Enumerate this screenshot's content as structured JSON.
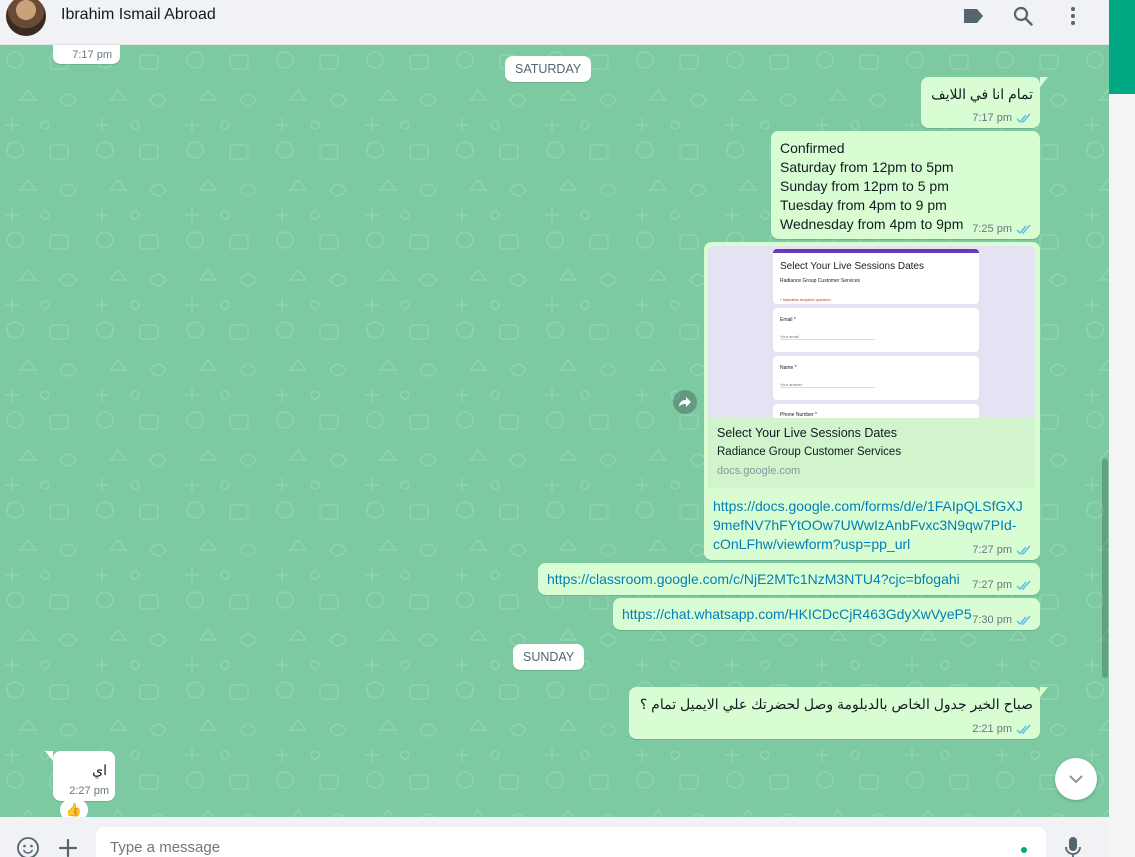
{
  "header": {
    "contact_name": "Ibrahim Ismail Abroad",
    "icons": [
      "label-icon",
      "search-icon",
      "menu-icon"
    ]
  },
  "colors": {
    "chat_background": "#7cc9a2",
    "outgoing_bubble": "#d9fdd3",
    "incoming_bubble": "#ffffff",
    "link": "#027eb5",
    "read_ticks": "#53bdeb",
    "accent": "#00a884"
  },
  "messages": {
    "prev_incoming_time": "7:17 pm",
    "date_saturday": "SATURDAY",
    "msg1": {
      "text": "تمام انا في اللايف",
      "time": "7:17 pm"
    },
    "msg2": {
      "lines": [
        "Confirmed",
        "Saturday from 12pm to 5pm",
        "Sunday from 12pm to 5 pm",
        "Tuesday from 4pm to 9 pm",
        "Wednesday from 4pm to 9pm"
      ],
      "time": "7:25 pm"
    },
    "msg3": {
      "preview_form_title": "Select Your Live Sessions Dates",
      "preview_form_subtitle": "Radiance Group Customer Services",
      "preview_form_required": "* Indicates required question",
      "preview_field_email": "Email *",
      "preview_field_email_placeholder": "Your email",
      "preview_field_name": "Name *",
      "preview_field_name_placeholder": "Your answer",
      "preview_field_phone": "Phone Number *",
      "card_title": "Select Your Live Sessions Dates",
      "card_description": "Radiance Group Customer Services",
      "card_domain": "docs.google.com",
      "link_lines": [
        "https://docs.google.com/forms/d/e/1FAIpQLSfGXJ",
        "9mefNV7hFYtOOw7UWwIzAnbFvxc3N9qw7PId-",
        "cOnLFhw/viewform?usp=pp_url"
      ],
      "time": "7:27 pm"
    },
    "msg4": {
      "link": "https://classroom.google.com/c/NjE2MTc1NzM3NTU4?cjc=bfogahi",
      "time": "7:27 pm"
    },
    "msg5": {
      "link": "https://chat.whatsapp.com/HKICDcCjR463GdyXwVyeP5",
      "time": "7:30 pm"
    },
    "date_sunday": "SUNDAY",
    "msg6": {
      "text": "صباح الخير جدول الخاص بالدبلومة وصل لحضرتك علي الايميل تمام ؟",
      "time": "2:21 pm"
    },
    "msg7": {
      "text": "اي",
      "time": "2:27 pm",
      "reaction": "👍"
    }
  },
  "footer": {
    "placeholder": "Type a message",
    "icons": [
      "emoji-icon",
      "attach-icon",
      "mic-icon"
    ]
  }
}
